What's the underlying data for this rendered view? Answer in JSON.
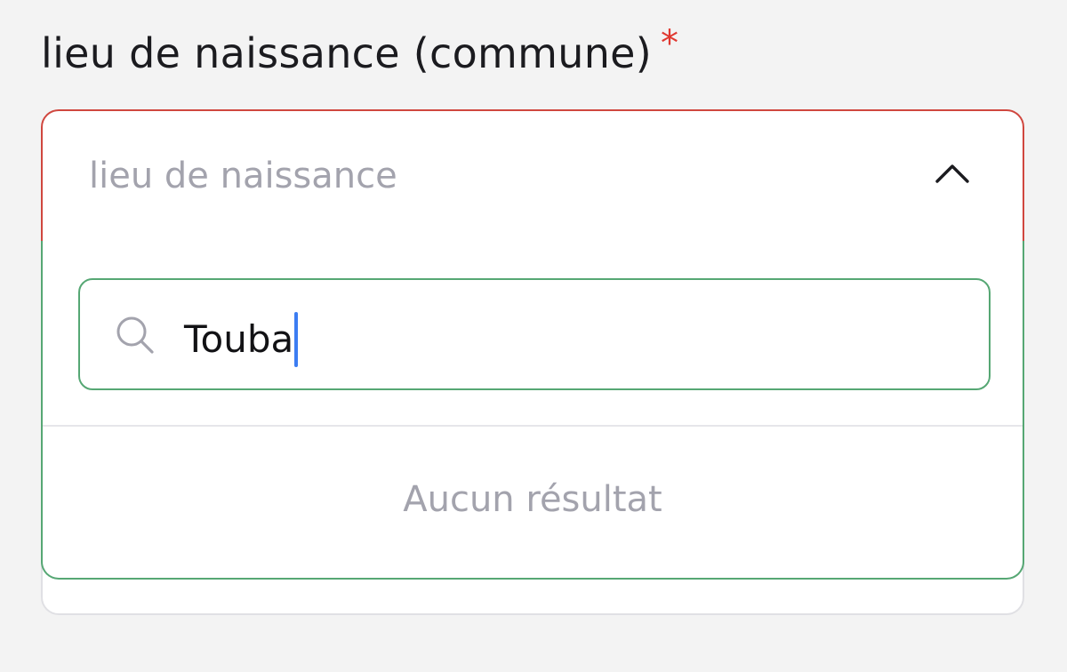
{
  "field": {
    "label": "lieu de naissance (commune)",
    "required_marker": "*",
    "placeholder": "lieu de naissance"
  },
  "search": {
    "value": "Touba"
  },
  "results": {
    "empty_message": "Aucun résultat"
  },
  "colors": {
    "error_border": "#d0473f",
    "focus_border": "#56a774",
    "required_star": "#e0372f",
    "caret": "#3c7df2",
    "placeholder_text": "#a3a3ad"
  },
  "icons": {
    "toggle": "chevron-up-icon",
    "search": "search-icon"
  }
}
